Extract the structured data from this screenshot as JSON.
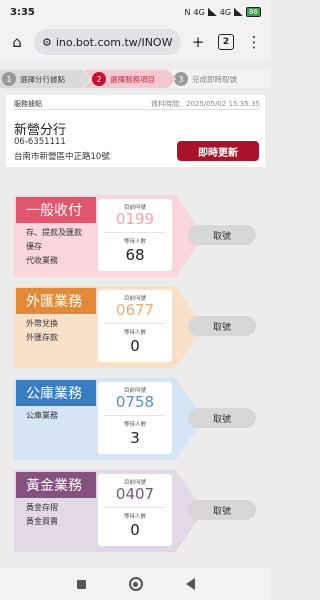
{
  "status_bar": {
    "time": "3:35",
    "icons": [
      "N",
      "4G",
      "4G"
    ],
    "battery": "86"
  },
  "browser": {
    "url": "ino.bot.com.tw/INOW",
    "tab_count": "2"
  },
  "steps": [
    {
      "num": "1",
      "label": "選擇分行據點"
    },
    {
      "num": "2",
      "label": "選擇服務項目"
    },
    {
      "num": "3",
      "label": "完成即時取號"
    }
  ],
  "branch": {
    "section_label": "服務據點",
    "time_label": "資料時間：",
    "time_value": "2025/05/02 15:35:35",
    "name": "新營分行",
    "phone": "06-6351111",
    "address": "台南市新營區中正路10號",
    "refresh_label": "即時更新"
  },
  "labels": {
    "current_number": "目前叫號",
    "waiting": "等待人數",
    "take_number": "取號"
  },
  "services": [
    {
      "name": "一般收付",
      "items": [
        "存、提款及匯款",
        "優存",
        "代收業務"
      ],
      "current": "0199",
      "waiting": "68",
      "card_color": "#f8d6dc",
      "cat_color": "#e0566d",
      "num_color": "#f2a3ae"
    },
    {
      "name": "外匯業務",
      "items": [
        "外幣兌換",
        "外匯存款"
      ],
      "current": "0677",
      "waiting": "0",
      "card_color": "#f9e0c8",
      "cat_color": "#e28a3a",
      "num_color": "#e7ae7d"
    },
    {
      "name": "公庫業務",
      "items": [
        "公庫業務"
      ],
      "current": "0758",
      "waiting": "3",
      "card_color": "#d6e5f3",
      "cat_color": "#3a7cc0",
      "num_color": "#5a8fc4"
    },
    {
      "name": "黃金業務",
      "items": [
        "黃金存摺",
        "黃金買賣"
      ],
      "current": "0407",
      "waiting": "0",
      "card_color": "#e3d8e8",
      "cat_color": "#85517e",
      "num_color": "#6f5a72"
    }
  ]
}
